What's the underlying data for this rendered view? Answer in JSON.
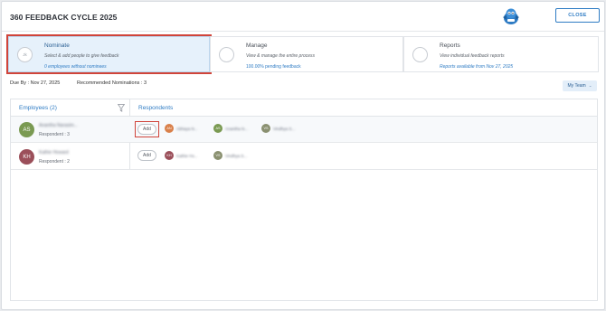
{
  "header": {
    "title": "360 FEEDBACK CYCLE 2025",
    "close_label": "CLOSE"
  },
  "steps": [
    {
      "icon_text": "Jk",
      "title": "Nominate",
      "desc": "Select & add people to give feedback",
      "link": "0 employees without nominees",
      "active": true
    },
    {
      "icon_text": "",
      "title": "Manage",
      "desc": "View & manage the entire process",
      "link": "100.00% pending feedback",
      "active": false
    },
    {
      "icon_text": "",
      "title": "Reports",
      "desc": "View individual feedback reports",
      "link": "Reports available from Nov 27, 2025",
      "active": false
    }
  ],
  "meta": {
    "due": "Due By : Nov 27, 2025",
    "recommended": "Recommended Nominations : 3",
    "team_select": "My Team"
  },
  "table": {
    "col_employees": "Employees (2)",
    "col_respondents": "Respondents",
    "rows": [
      {
        "initials": "AS",
        "avatar_color": "#7a9a52",
        "name": "Anantha Narasim...",
        "sub": "Respondent : 3",
        "add_label": "Add",
        "respondents": [
          {
            "initials": "AN",
            "color": "#d9804a",
            "name": "Abhaya N..."
          },
          {
            "initials": "AS",
            "color": "#7a9a52",
            "name": "Anantha N..."
          },
          {
            "initials": "VS",
            "color": "#8a9070",
            "name": "Vindhya S..."
          }
        ]
      },
      {
        "initials": "KH",
        "avatar_color": "#9b4f5a",
        "name": "Kathie Howard",
        "sub": "Respondent : 2",
        "add_label": "Add",
        "respondents": [
          {
            "initials": "KH",
            "color": "#9b4f5a",
            "name": "Kathie Ho..."
          },
          {
            "initials": "VS",
            "color": "#8a9070",
            "name": "Vindhya S..."
          }
        ]
      }
    ]
  },
  "colors": {
    "accent": "#2f7cc4",
    "highlight": "#d0443a",
    "active_step_bg": "#e6f1fb"
  }
}
